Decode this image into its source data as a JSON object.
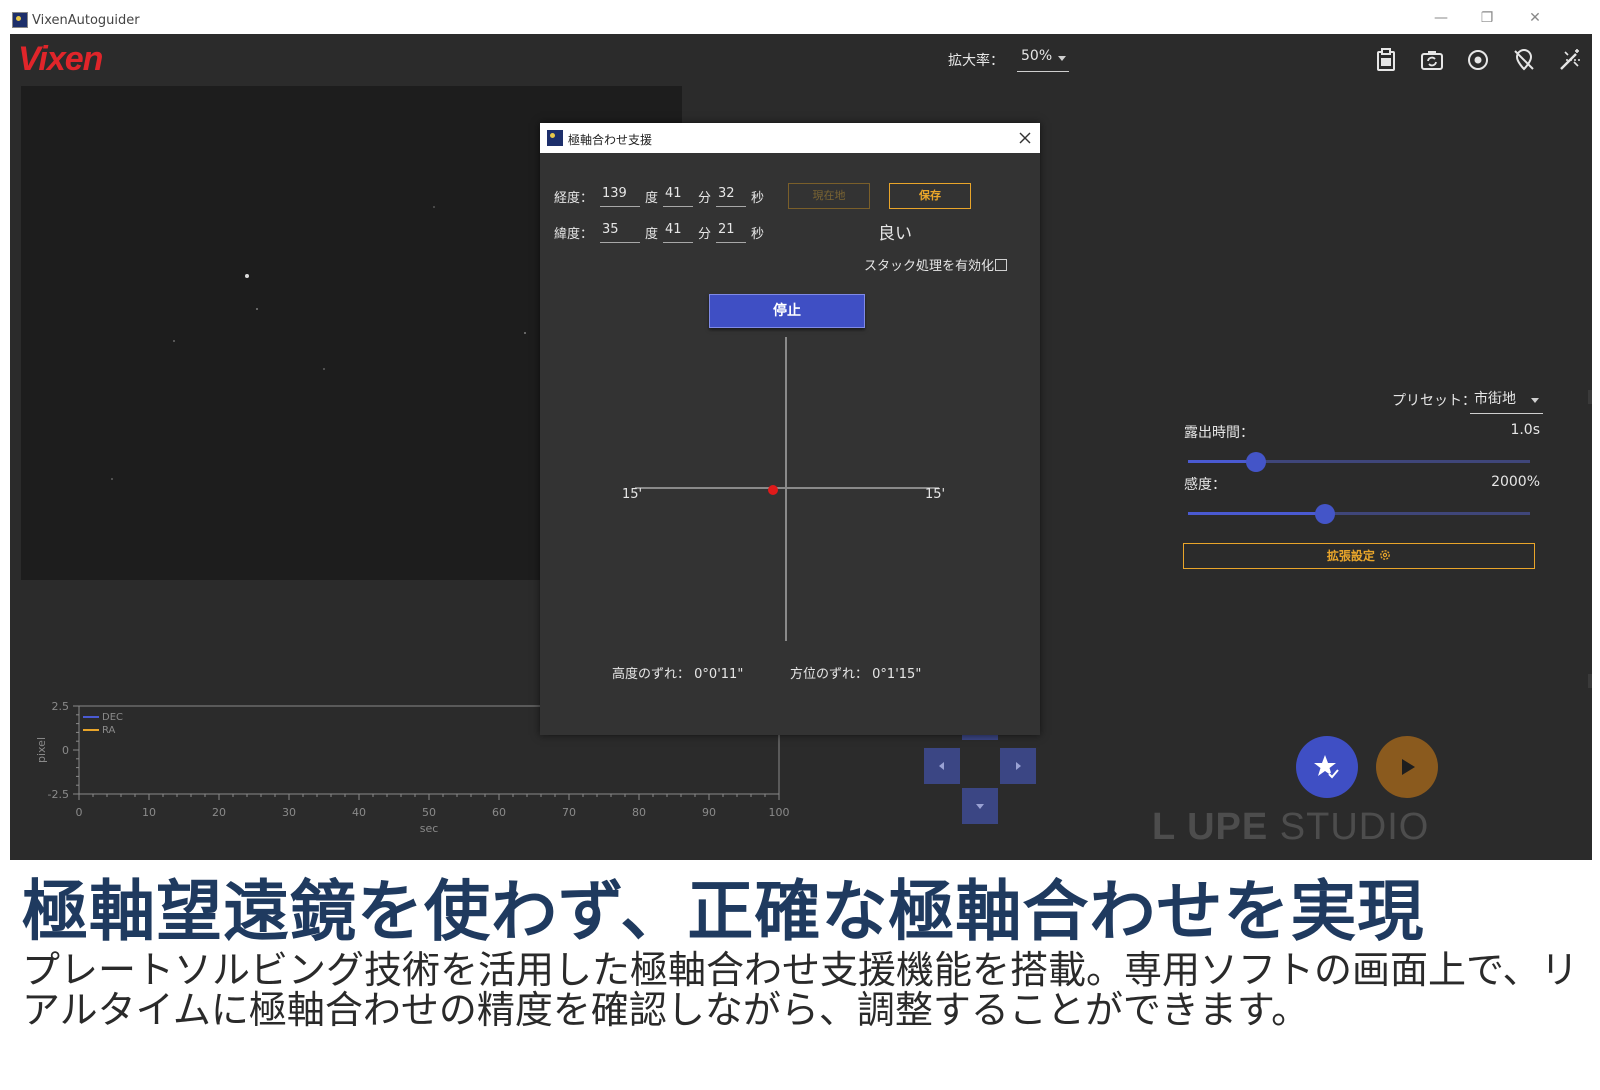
{
  "window": {
    "title": "VixenAutoguider",
    "minimize": "—",
    "restore": "❐",
    "close": "✕"
  },
  "app": {
    "logo": "Vixen",
    "zoom_label": "拡大率：",
    "zoom_value": "50%",
    "toolbar_icons": [
      "clipboard-icon",
      "camera-refresh-icon",
      "target-icon",
      "no-pin-icon",
      "magic-wand-icon"
    ]
  },
  "graph": {
    "ylabel": "pixel",
    "xlabel": "sec",
    "y_ticks": [
      "2.5",
      "0",
      "-2.5"
    ],
    "x_ticks": [
      "0",
      "10",
      "20",
      "30",
      "40",
      "50",
      "60",
      "70",
      "80",
      "90",
      "100"
    ],
    "legend": [
      {
        "name": "DEC",
        "color": "#4a5ad2"
      },
      {
        "name": "RA",
        "color": "#e9a52a"
      }
    ]
  },
  "panel": {
    "preset_label": "プリセット：",
    "preset_value": "市街地",
    "exposure_label": "露出時間：",
    "exposure_value": "1.0s",
    "exposure_fraction": 0.2,
    "gain_label": "感度：",
    "gain_value": "2000%",
    "gain_fraction": 0.4,
    "ext_settings_label": "拡張設定",
    "ext_settings_icon": "gear-icon"
  },
  "dialog": {
    "title": "極軸合わせ支援",
    "longitude_label": "経度：",
    "longitude": {
      "deg": "139",
      "min": "41",
      "sec": "32"
    },
    "latitude_label": "緯度：",
    "latitude": {
      "deg": "35",
      "min": "41",
      "sec": "21"
    },
    "unit_deg": "度",
    "unit_min": "分",
    "unit_sec": "秒",
    "current_location_button": "現在地",
    "save_button": "保存",
    "quality": "良い",
    "stack_label": "スタック処理を有効化",
    "stop_button": "停止",
    "scale_left": "15'",
    "scale_right": "15'",
    "altitude_label": "高度のずれ：",
    "altitude_value": "0°0'11\"",
    "azimuth_label": "方位のずれ：",
    "azimuth_value": "0°1'15\""
  },
  "watermark": {
    "bold": "L  UPE",
    "light": "STUDIO"
  },
  "caption": {
    "title": "極軸望遠鏡を使わず、正確な極軸合わせを実現",
    "body": "プレートソルビング技術を活用した極軸合わせ支援機能を搭載。専用ソフトの画面上で、リアルタイムに極軸合わせの精度を確認しながら、調整することができます。"
  }
}
